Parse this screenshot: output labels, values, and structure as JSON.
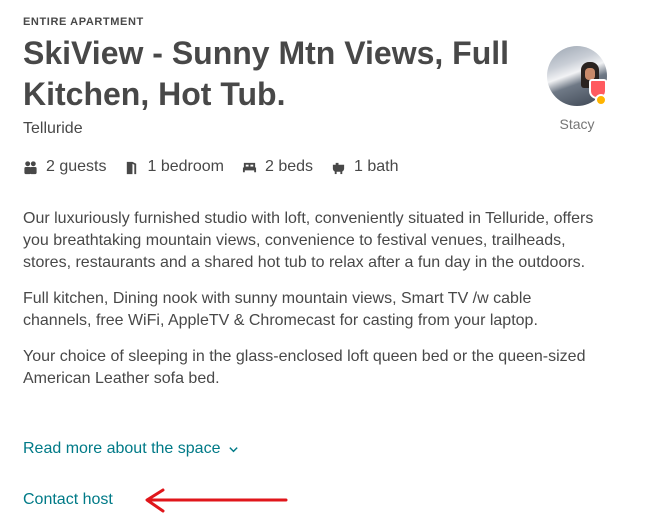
{
  "listing": {
    "type_label": "ENTIRE APARTMENT",
    "title": "SkiView - Sunny Mtn Views, Full Kitchen, Hot Tub.",
    "location": "Telluride"
  },
  "host": {
    "name": "Stacy",
    "avatar_icon": "host-avatar",
    "badge_icon": "superhost-badge-icon"
  },
  "amenities": [
    {
      "icon": "guests-icon",
      "label": "2 guests"
    },
    {
      "icon": "bedroom-icon",
      "label": "1 bedroom"
    },
    {
      "icon": "bed-icon",
      "label": "2 beds"
    },
    {
      "icon": "bath-icon",
      "label": "1 bath"
    }
  ],
  "description": [
    "Our luxuriously furnished studio with loft, conveniently situated in Telluride, offers you breathtaking mountain views, convenience to festival venues, trailheads, stores, restaurants and a shared hot tub to relax after a fun day in the outdoors.",
    "Full kitchen, Dining nook with sunny mountain views, Smart TV /w cable channels, free WiFi, AppleTV & Chromecast for casting from your laptop.",
    "Your choice of sleeping in the glass-enclosed loft queen bed or the queen-sized American Leather sofa bed."
  ],
  "actions": {
    "read_more": "Read more about the space",
    "contact_host": "Contact host"
  },
  "colors": {
    "text": "#484848",
    "link": "#007a87",
    "annotation_arrow": "#e0161b"
  }
}
